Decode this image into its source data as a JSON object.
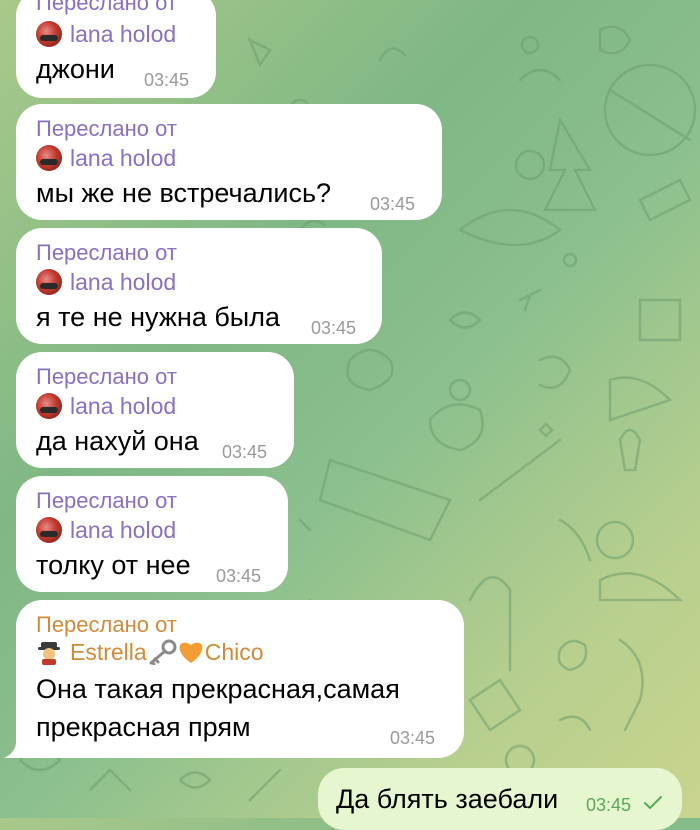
{
  "messages": [
    {
      "label": "Переслано от",
      "sender": "lana holod",
      "text": "джони",
      "time": "03:45"
    },
    {
      "label": "Переслано от",
      "sender": "lana holod",
      "text": "мы же не встречались?",
      "time": "03:45"
    },
    {
      "label": "Переслано от",
      "sender": "lana holod",
      "text": "я те не нужна была",
      "time": "03:45"
    },
    {
      "label": "Переслано от",
      "sender": "lana holod",
      "text": "да нахуй она",
      "time": "03:45"
    },
    {
      "label": "Переслано от",
      "sender": "lana holod",
      "text": "толку от нее",
      "time": "03:45"
    }
  ],
  "last_forward": {
    "label": "Переслано от",
    "sender_part1": "Estrella",
    "sender_part2": "Chico",
    "line1": "Она такая прекрасная,самая",
    "line2": "прекрасная прям",
    "time": "03:45"
  },
  "outgoing": {
    "text": "Да блять заебали",
    "time": "03:45",
    "status_icon": "check-icon"
  },
  "colors": {
    "forward_purple": "#8a6fc3",
    "forward_orange": "#d28a3b",
    "outgoing_bubble": "#e6f6cf",
    "incoming_bubble": "#ffffff"
  }
}
